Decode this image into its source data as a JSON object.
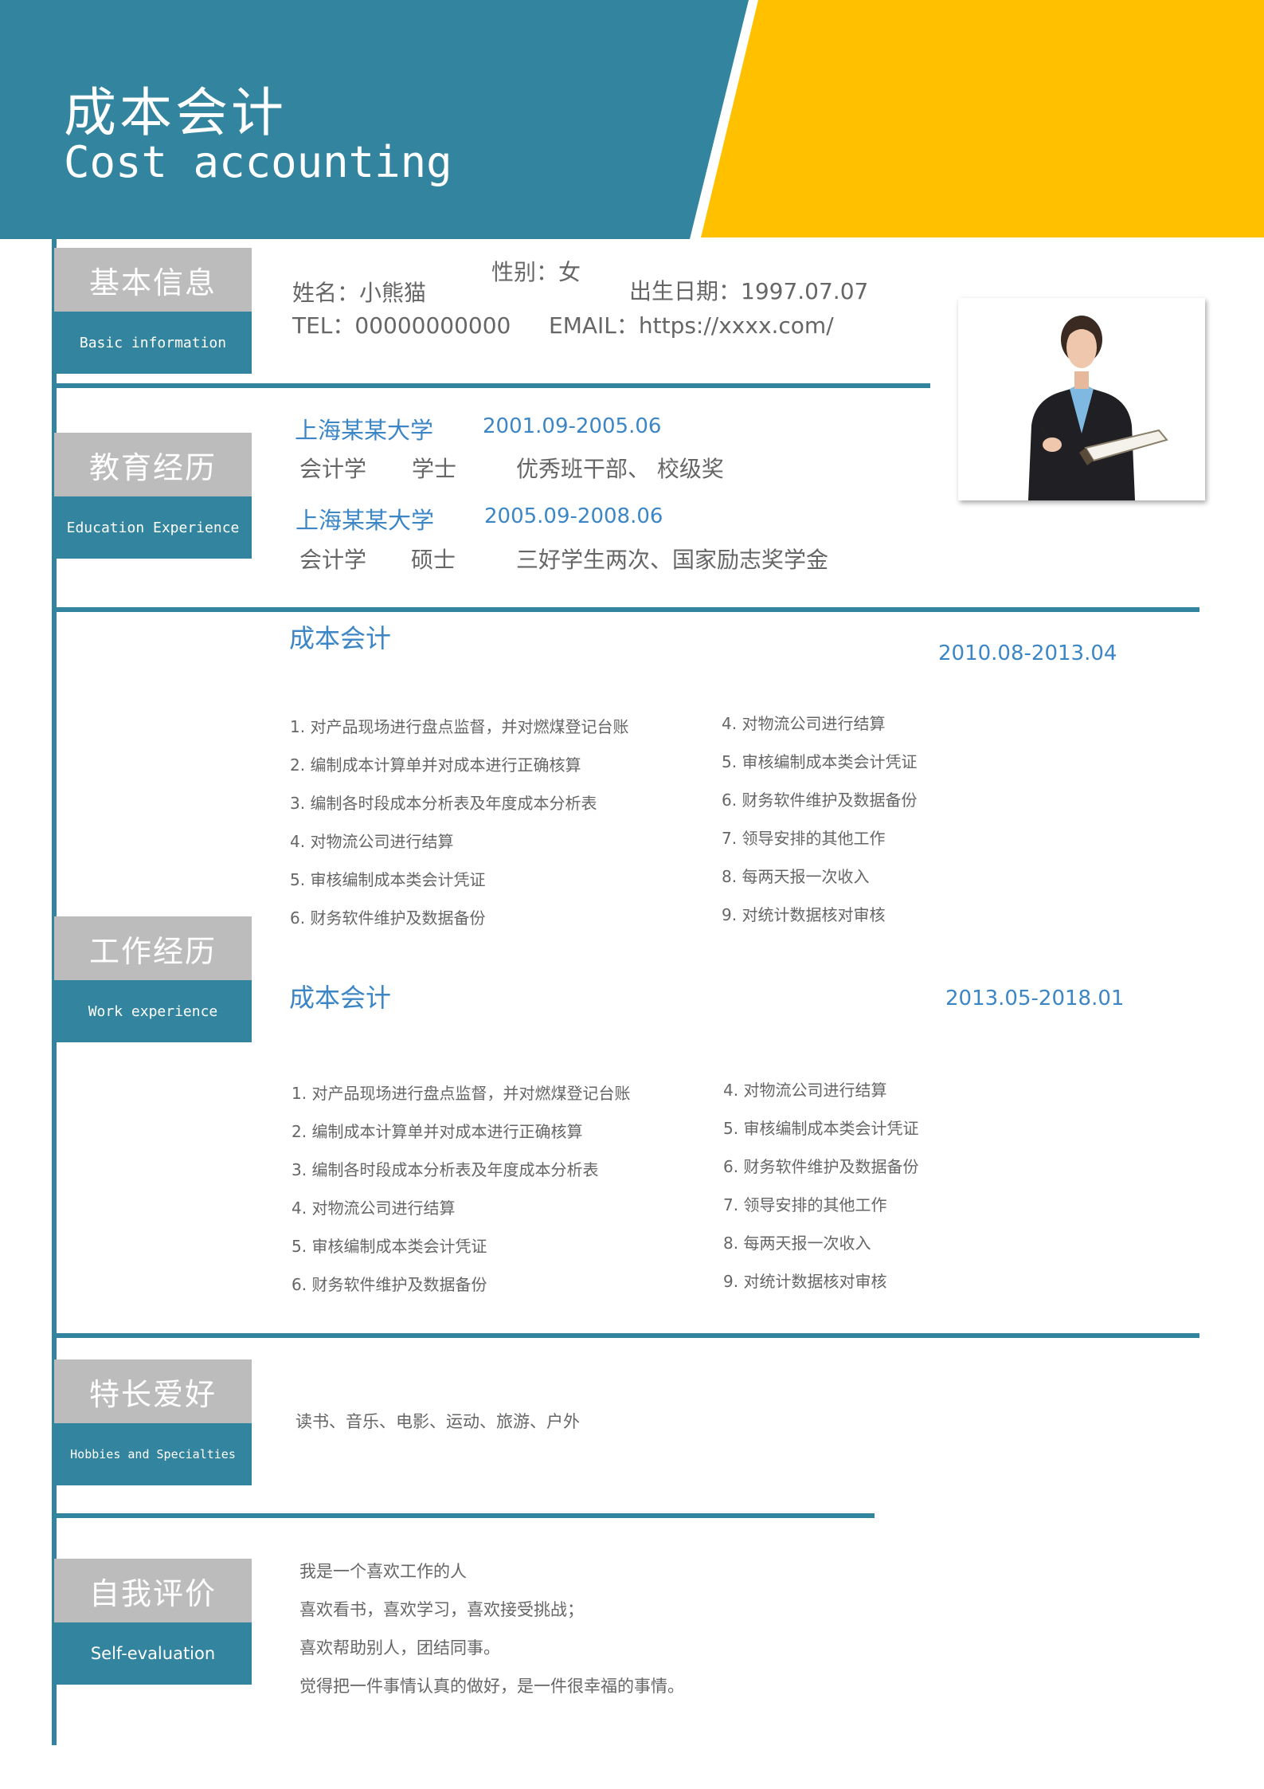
{
  "header": {
    "title_cn": "成本会计",
    "title_en": "Cost accounting",
    "colors": {
      "teal": "#33849e",
      "yellow": "#ffc000",
      "label_gray": "#bcbcbc",
      "accent_blue": "#3d86c6"
    }
  },
  "sections": {
    "basic": {
      "cn": "基本信息",
      "en": "Basic information"
    },
    "education": {
      "cn": "教育经历",
      "en": "Education Experience"
    },
    "work": {
      "cn": "工作经历",
      "en": "Work experience"
    },
    "hobbies": {
      "cn": "特长爱好",
      "en": "Hobbies and Specialties"
    },
    "self": {
      "cn": "自我评价",
      "en": "Self-evaluation"
    }
  },
  "basic_info": {
    "name": "姓名：小熊猫",
    "gender": "性别：女",
    "birth": "出生日期：1997.07.07",
    "tel": "TEL：00000000000",
    "email": "EMAIL：https://xxxx.com/",
    "photo_icon": "portrait-photo"
  },
  "education": [
    {
      "school": "上海某某大学",
      "period": "2001.09-2005.06",
      "major": "会计学",
      "degree": "学士",
      "honor": "优秀班干部、 校级奖"
    },
    {
      "school": "上海某某大学",
      "period": "2005.09-2008.06",
      "major": "会计学",
      "degree": "硕士",
      "honor": "三好学生两次、国家励志奖学金"
    }
  ],
  "work": [
    {
      "title": "成本会计",
      "period": "2010.08-2013.04",
      "left": [
        "1. 对产品现场进行盘点监督，并对燃煤登记台账",
        "2. 编制成本计算单并对成本进行正确核算",
        "3. 编制各时段成本分析表及年度成本分析表",
        "4. 对物流公司进行结算",
        "5. 审核编制成本类会计凭证",
        "6. 财务软件维护及数据备份"
      ],
      "right": [
        "4. 对物流公司进行结算",
        "5. 审核编制成本类会计凭证",
        "6. 财务软件维护及数据备份",
        "7. 领导安排的其他工作",
        "8. 每两天报一次收入",
        "9. 对统计数据核对审核"
      ]
    },
    {
      "title": "成本会计",
      "period": "2013.05-2018.01",
      "left": [
        "1. 对产品现场进行盘点监督，并对燃煤登记台账",
        "2. 编制成本计算单并对成本进行正确核算",
        "3. 编制各时段成本分析表及年度成本分析表",
        "4. 对物流公司进行结算",
        "5. 审核编制成本类会计凭证",
        "6. 财务软件维护及数据备份"
      ],
      "right": [
        "4. 对物流公司进行结算",
        "5. 审核编制成本类会计凭证",
        "6. 财务软件维护及数据备份",
        "7. 领导安排的其他工作",
        "8. 每两天报一次收入",
        "9. 对统计数据核对审核"
      ]
    }
  ],
  "hobbies": "读书、音乐、电影、运动、旅游、户外",
  "self_eval": [
    "我是一个喜欢工作的人",
    "喜欢看书，喜欢学习，喜欢接受挑战；",
    "喜欢帮助别人，团结同事。",
    "觉得把一件事情认真的做好，是一件很幸福的事情。"
  ]
}
